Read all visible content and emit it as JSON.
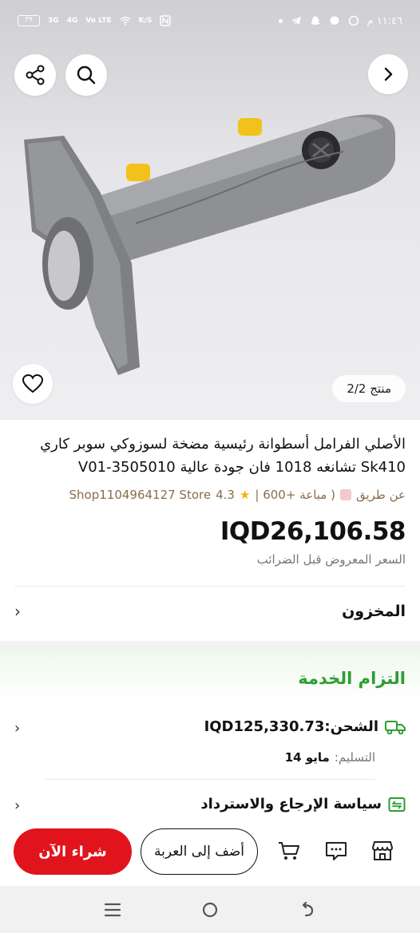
{
  "status_bar": {
    "time": "١١:٤٦ م",
    "battery": "٣٩",
    "network_1": "3G",
    "network_2": "4G",
    "volte": "Vo LTE",
    "speed": "K/S"
  },
  "gallery": {
    "counter": "منتج 2/2"
  },
  "product": {
    "title": "الأصلي الفرامل أسطوانة رئيسية مضخة لسوزوكي سوبر كاري Sk410 تشانغه 1018 فان جودة عالية V01-3505010",
    "seller_prefix": "عن طريق",
    "sold_count": "( مباعة +600 |",
    "rating": "4.3",
    "store_name": "Shop1104964127 Store",
    "price": "IQD26,106.58",
    "tax_note": "السعر المعروض قبل الضرائب"
  },
  "inventory": {
    "label": "المخزون"
  },
  "service": {
    "title": "التزام الخدمة",
    "shipping_text": "الشحن:IQD125,330.73",
    "delivery_label": "التسليم:",
    "delivery_date": "مايو 14",
    "return_policy": "سياسة الإرجاع والاسترداد"
  },
  "actions": {
    "add_to_cart": "أضف إلى العربة",
    "buy_now": "شراء الآن"
  },
  "colors": {
    "accent_red": "#e1141d",
    "service_green": "#2e9e33",
    "seller_brown": "#8a6d4b"
  }
}
